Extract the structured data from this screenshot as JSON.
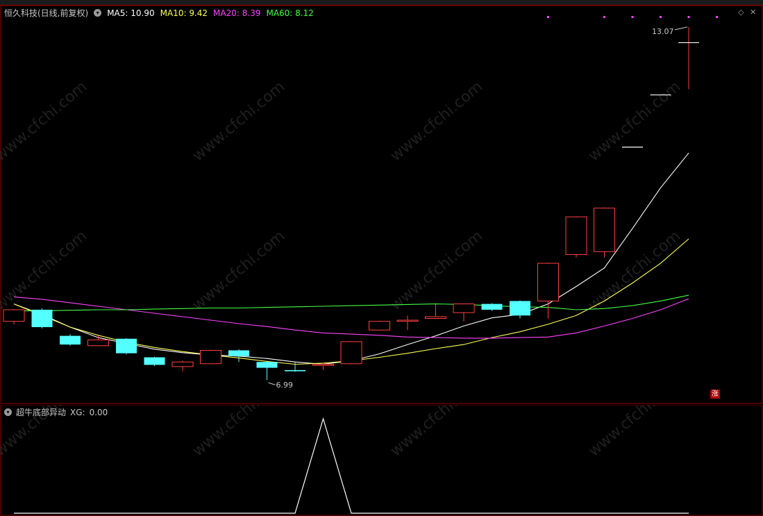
{
  "header": {
    "title": "恒久科技(日线,前复权)",
    "ma": [
      {
        "label": "MA5:",
        "value": "10.90",
        "color": "#ffffff"
      },
      {
        "label": "MA10:",
        "value": "9.42",
        "color": "#ffff55"
      },
      {
        "label": "MA20:",
        "value": "8.39",
        "color": "#ff44ff"
      },
      {
        "label": "MA60:",
        "value": "8.12",
        "color": "#44ff44"
      }
    ]
  },
  "sub_header": {
    "indicator": "超牛底部异动",
    "xg_label": "XG:",
    "xg_value": "0.00"
  },
  "badge": "涨",
  "watermark": "www.cfchi.com",
  "chart_data": [
    {
      "type": "candlestick",
      "annotations": [
        {
          "text": "13.07",
          "price": 13.07,
          "kind": "high"
        },
        {
          "text": "6.99",
          "price": 6.99,
          "kind": "low"
        }
      ],
      "ylim": [
        6.8,
        13.2
      ],
      "candles": [
        {
          "o": 8.0,
          "c": 8.2,
          "h": 8.21,
          "l": 7.95
        },
        {
          "o": 8.2,
          "c": 7.9,
          "h": 8.22,
          "l": 7.88
        },
        {
          "o": 7.75,
          "c": 7.6,
          "h": 7.78,
          "l": 7.58
        },
        {
          "o": 7.58,
          "c": 7.68,
          "h": 7.75,
          "l": 7.57
        },
        {
          "o": 7.7,
          "c": 7.45,
          "h": 7.71,
          "l": 7.43
        },
        {
          "o": 7.38,
          "c": 7.25,
          "h": 7.39,
          "l": 7.23
        },
        {
          "o": 7.22,
          "c": 7.3,
          "h": 7.32,
          "l": 7.14
        },
        {
          "o": 7.27,
          "c": 7.5,
          "h": 7.51,
          "l": 7.26
        },
        {
          "o": 7.5,
          "c": 7.4,
          "h": 7.52,
          "l": 7.3
        },
        {
          "o": 7.3,
          "c": 7.2,
          "h": 7.32,
          "l": 6.99
        },
        {
          "o": 7.16,
          "c": 7.14,
          "h": 7.3,
          "l": 7.13
        },
        {
          "o": 7.24,
          "c": 7.26,
          "h": 7.28,
          "l": 7.16
        },
        {
          "o": 7.27,
          "c": 7.65,
          "h": 7.66,
          "l": 7.26
        },
        {
          "o": 7.85,
          "c": 8.0,
          "h": 8.01,
          "l": 7.84
        },
        {
          "o": 8.0,
          "c": 8.02,
          "h": 8.1,
          "l": 7.85
        },
        {
          "o": 8.05,
          "c": 8.08,
          "h": 8.3,
          "l": 8.04
        },
        {
          "o": 8.15,
          "c": 8.3,
          "h": 8.31,
          "l": 8.0
        },
        {
          "o": 8.3,
          "c": 8.2,
          "h": 8.31,
          "l": 8.18
        },
        {
          "o": 8.35,
          "c": 8.1,
          "h": 8.36,
          "l": 8.05
        },
        {
          "o": 8.35,
          "c": 9.0,
          "h": 9.01,
          "l": 8.05
        },
        {
          "o": 9.15,
          "c": 9.8,
          "h": 9.81,
          "l": 9.1
        },
        {
          "o": 9.2,
          "c": 9.95,
          "h": 9.96,
          "l": 9.1
        },
        {
          "o": 11.0,
          "c": 11.0,
          "h": 11.0,
          "l": 11.0
        },
        {
          "o": 11.9,
          "c": 11.9,
          "h": 11.9,
          "l": 11.9
        },
        {
          "o": 12.8,
          "c": 12.8,
          "h": 13.07,
          "l": 12.0
        }
      ],
      "ma_series": [
        {
          "name": "MA5",
          "color": "#ffffff",
          "values": [
            8.3,
            8.12,
            7.9,
            7.72,
            7.62,
            7.52,
            7.46,
            7.42,
            7.4,
            7.36,
            7.3,
            7.26,
            7.32,
            7.44,
            7.6,
            7.75,
            7.92,
            8.06,
            8.12,
            8.3,
            8.6,
            8.92,
            9.6,
            10.3,
            10.9
          ]
        },
        {
          "name": "MA10",
          "color": "#ffff55",
          "values": [
            8.3,
            8.1,
            7.9,
            7.76,
            7.64,
            7.55,
            7.48,
            7.42,
            7.37,
            7.31,
            7.26,
            7.28,
            7.32,
            7.38,
            7.45,
            7.53,
            7.6,
            7.72,
            7.82,
            7.95,
            8.1,
            8.35,
            8.66,
            9.0,
            9.42
          ]
        },
        {
          "name": "MA20",
          "color": "#ff44ff",
          "values": [
            8.42,
            8.38,
            8.32,
            8.26,
            8.2,
            8.14,
            8.08,
            8.02,
            7.96,
            7.91,
            7.85,
            7.8,
            7.78,
            7.76,
            7.73,
            7.72,
            7.71,
            7.71,
            7.72,
            7.73,
            7.8,
            7.92,
            8.05,
            8.2,
            8.39
          ]
        },
        {
          "name": "MA60",
          "color": "#44ff44",
          "values": [
            8.18,
            8.18,
            8.19,
            8.2,
            8.2,
            8.21,
            8.22,
            8.23,
            8.23,
            8.24,
            8.25,
            8.26,
            8.27,
            8.28,
            8.29,
            8.3,
            8.29,
            8.27,
            8.25,
            8.24,
            8.2,
            8.22,
            8.27,
            8.35,
            8.45
          ]
        }
      ]
    },
    {
      "type": "line",
      "title": "超牛底部异动",
      "values": [
        0,
        0,
        0,
        0,
        0,
        0,
        0,
        0,
        0,
        0,
        0,
        1,
        0,
        0,
        0,
        0,
        0,
        0,
        0,
        0,
        0,
        0,
        0,
        0,
        0
      ],
      "ylim": [
        0,
        1
      ]
    }
  ]
}
